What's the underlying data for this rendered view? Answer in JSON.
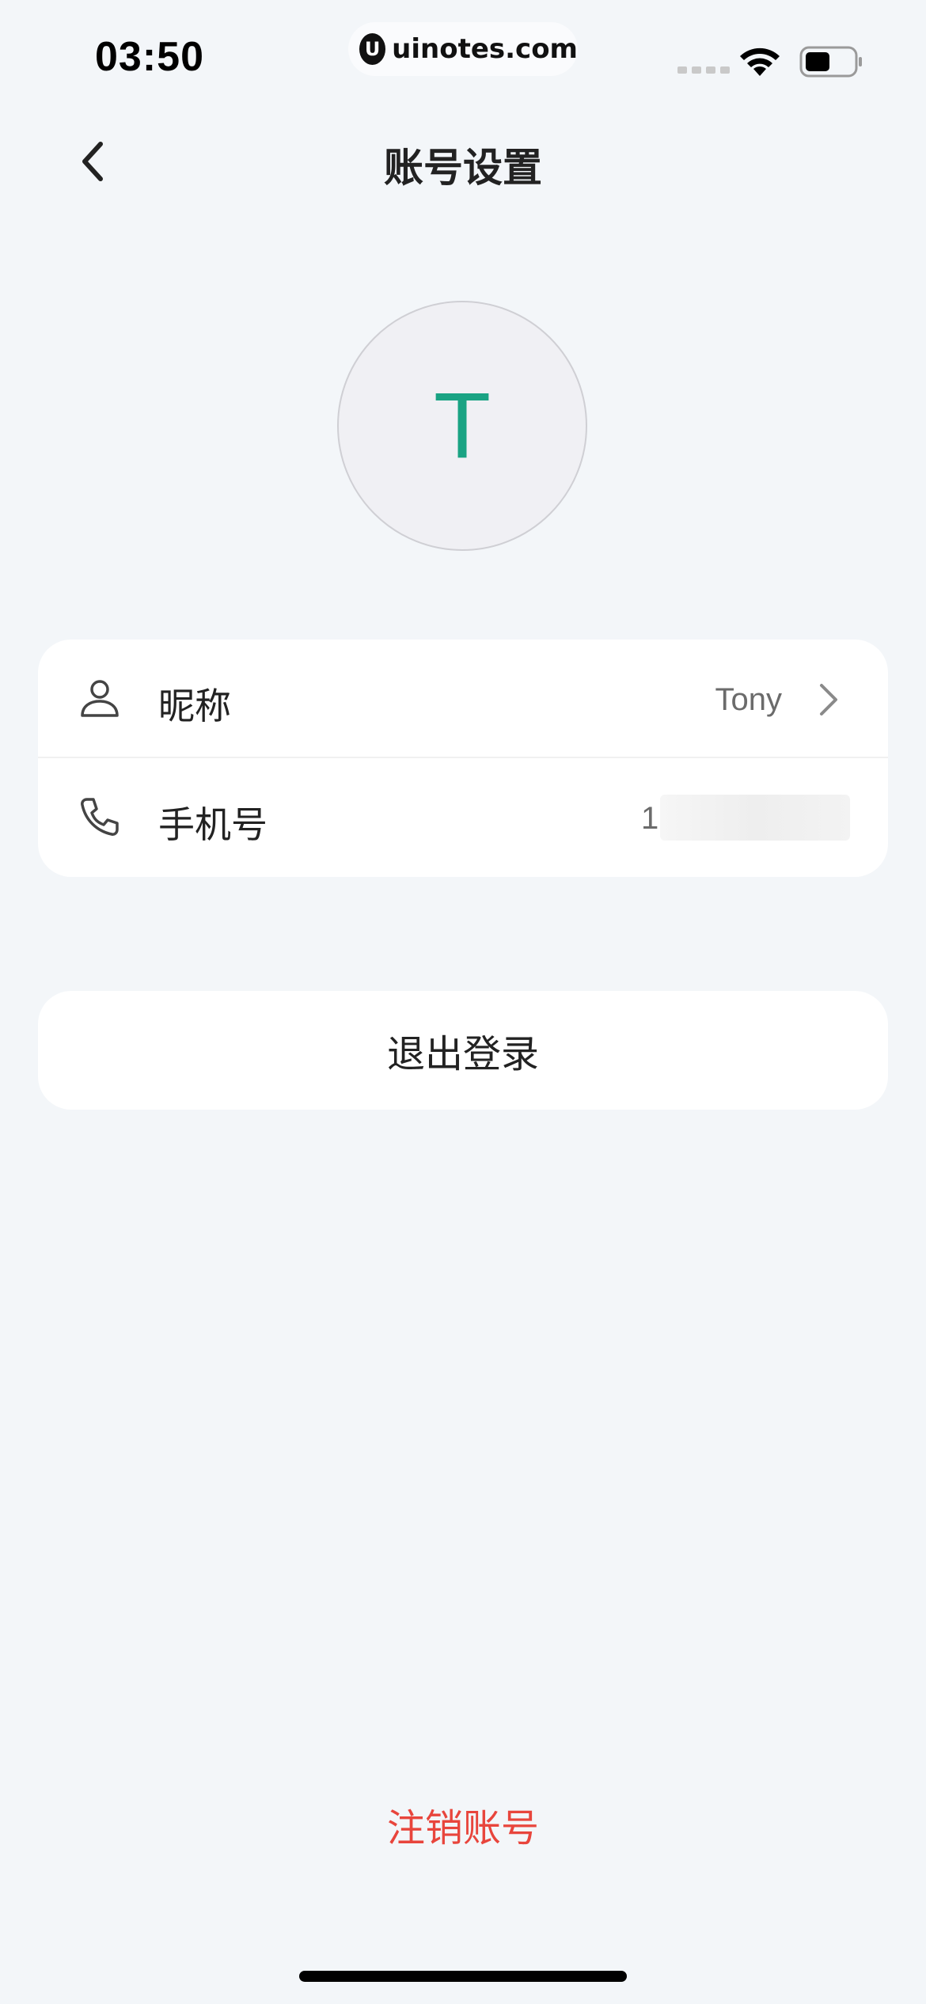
{
  "status_bar": {
    "time": "03:50",
    "watermark_logo": "U",
    "watermark": "uinotes.com"
  },
  "nav": {
    "title": "账号设置",
    "back_icon": "chevron-left-icon"
  },
  "avatar": {
    "letter": "T",
    "color": "#1aa383"
  },
  "profile": {
    "nickname_label": "昵称",
    "nickname_value": "Tony",
    "phone_label": "手机号",
    "phone_value": "1"
  },
  "actions": {
    "logout_label": "退出登录",
    "delete_label": "注销账号"
  },
  "colors": {
    "background": "#f3f6f9",
    "danger": "#e8453c",
    "accent": "#1aa383"
  }
}
